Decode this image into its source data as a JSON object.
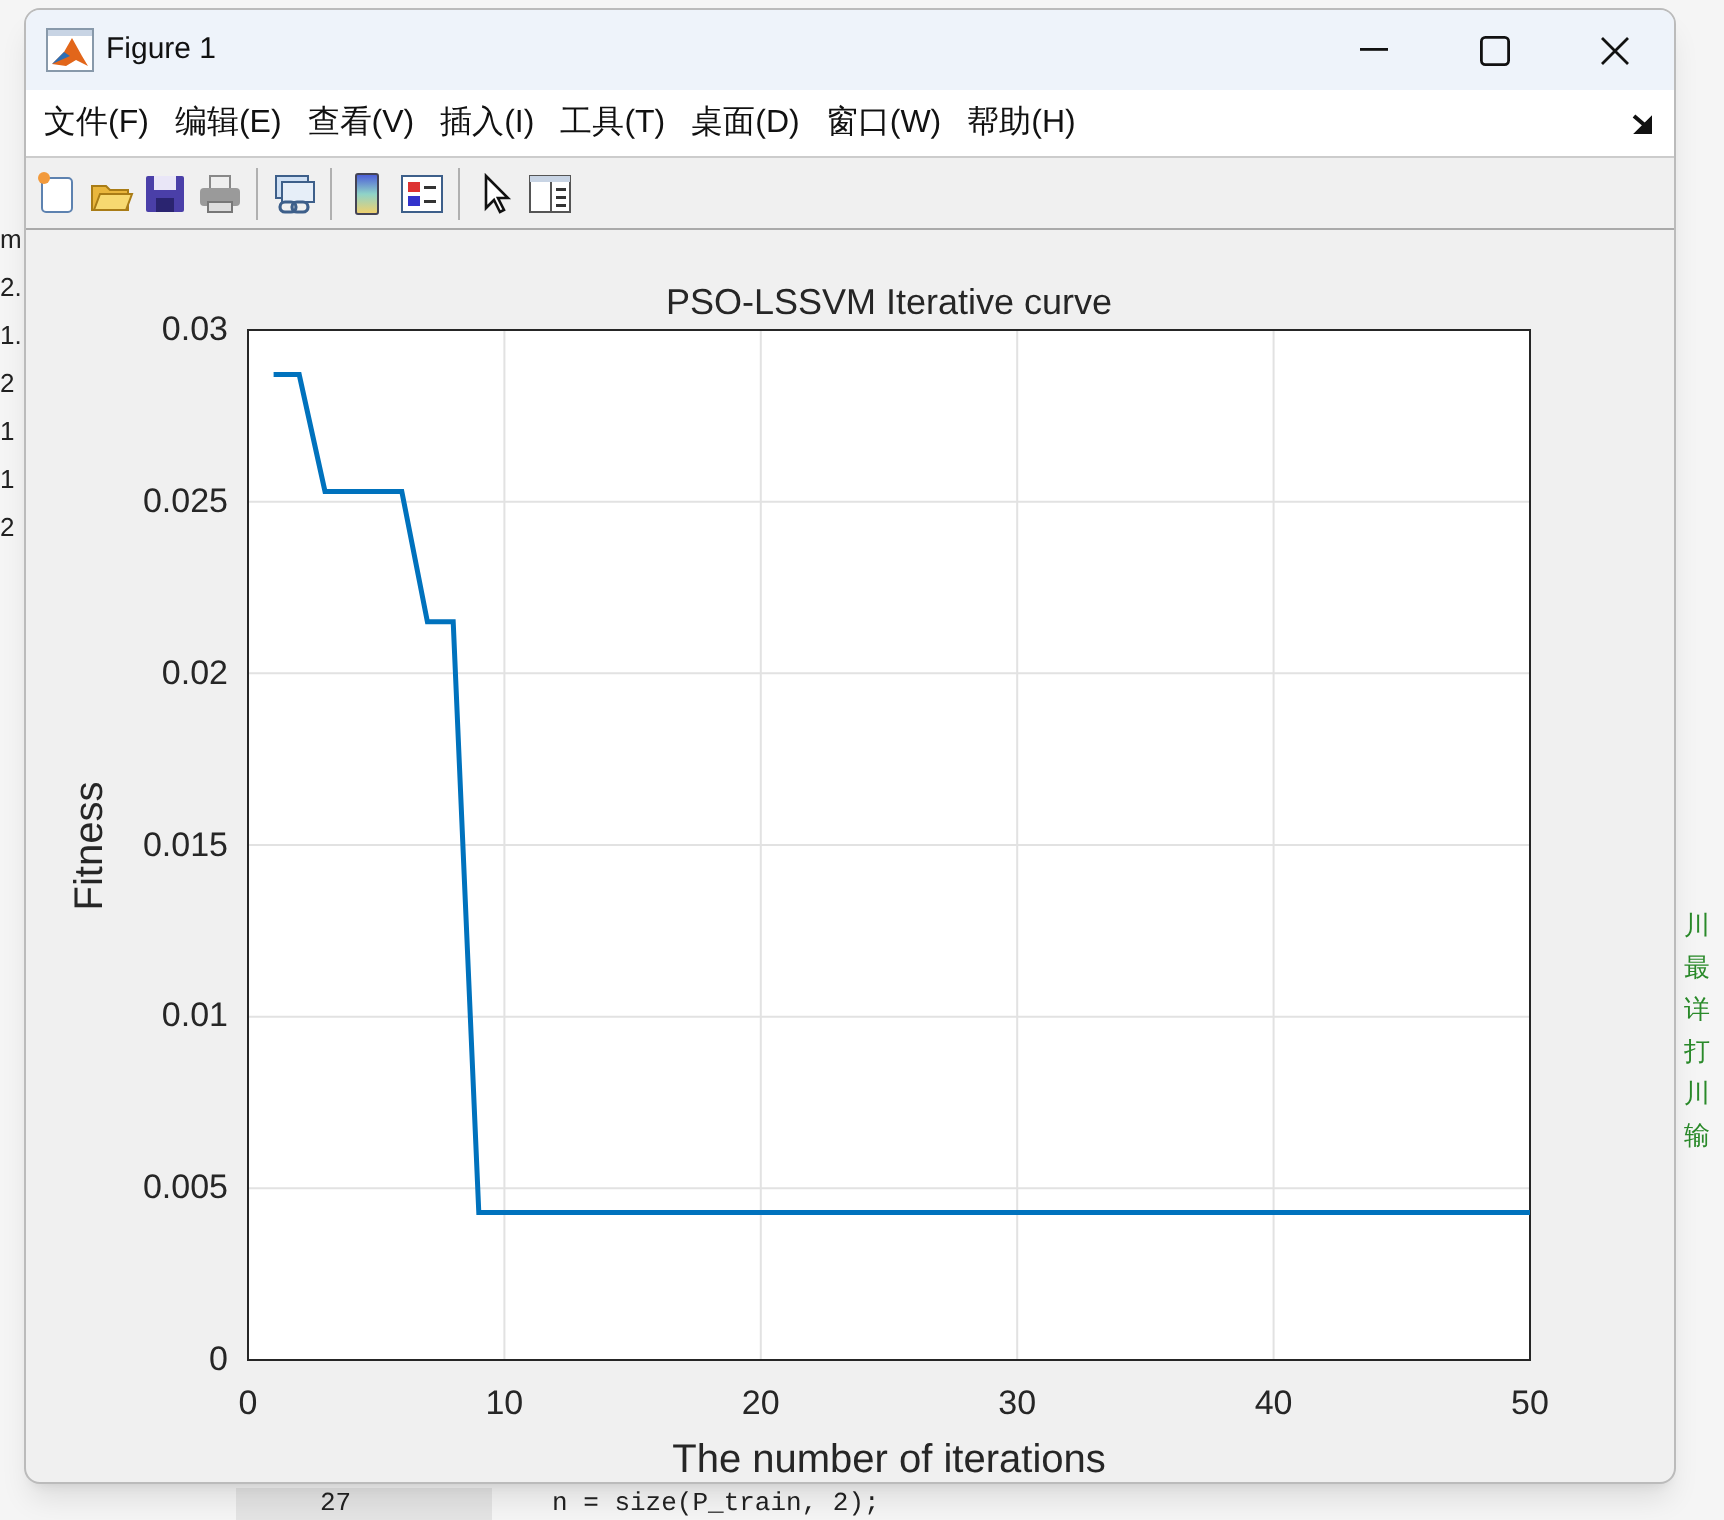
{
  "window": {
    "title": "Figure 1"
  },
  "menu": [
    {
      "label": "文件(F)"
    },
    {
      "label": "编辑(E)"
    },
    {
      "label": "查看(V)"
    },
    {
      "label": "插入(I)"
    },
    {
      "label": "工具(T)"
    },
    {
      "label": "桌面(D)"
    },
    {
      "label": "窗口(W)"
    },
    {
      "label": "帮助(H)"
    }
  ],
  "toolbar": [
    {
      "kind": "new"
    },
    {
      "kind": "open"
    },
    {
      "kind": "save"
    },
    {
      "kind": "print"
    },
    {
      "kind": "sep"
    },
    {
      "kind": "link"
    },
    {
      "kind": "sep"
    },
    {
      "kind": "colorbar"
    },
    {
      "kind": "legend"
    },
    {
      "kind": "sep"
    },
    {
      "kind": "pointer"
    },
    {
      "kind": "panel"
    }
  ],
  "plot": {
    "chart_data": {
      "type": "line",
      "title": "PSO-LSSVM Iterative curve",
      "xlabel": "The number of iterations",
      "ylabel": "Fitness",
      "x": [
        1,
        2,
        3,
        4,
        5,
        6,
        7,
        8,
        9,
        10,
        11,
        12,
        13,
        14,
        15,
        16,
        17,
        18,
        19,
        20,
        21,
        22,
        23,
        24,
        25,
        26,
        27,
        28,
        29,
        30,
        31,
        32,
        33,
        34,
        35,
        36,
        37,
        38,
        39,
        40,
        41,
        42,
        43,
        44,
        45,
        46,
        47,
        48,
        49,
        50
      ],
      "series": [
        {
          "color": "#0072bd",
          "values": [
            0.0287,
            0.0287,
            0.0253,
            0.0253,
            0.0253,
            0.0253,
            0.0215,
            0.0215,
            0.0043,
            0.0043,
            0.0043,
            0.0043,
            0.0043,
            0.0043,
            0.0043,
            0.0043,
            0.0043,
            0.0043,
            0.0043,
            0.0043,
            0.0043,
            0.0043,
            0.0043,
            0.0043,
            0.0043,
            0.0043,
            0.0043,
            0.0043,
            0.0043,
            0.0043,
            0.0043,
            0.0043,
            0.0043,
            0.0043,
            0.0043,
            0.0043,
            0.0043,
            0.0043,
            0.0043,
            0.0043,
            0.0043,
            0.0043,
            0.0043,
            0.0043,
            0.0043,
            0.0043,
            0.0043,
            0.0043,
            0.0043,
            0.0043
          ]
        }
      ],
      "grid": true,
      "xlim": [
        0,
        50
      ],
      "ylim": [
        0,
        0.03
      ],
      "xticks": [
        0,
        10,
        20,
        30,
        40,
        50
      ],
      "yticks": [
        {
          "value": 0,
          "label": "0"
        },
        {
          "value": 0.005,
          "label": "0.005"
        },
        {
          "value": 0.01,
          "label": "0.01"
        },
        {
          "value": 0.015,
          "label": "0.015"
        },
        {
          "value": 0.02,
          "label": "0.02"
        },
        {
          "value": 0.025,
          "label": "0.025"
        },
        {
          "value": 0.03,
          "label": "0.03"
        }
      ]
    }
  },
  "background_editor": {
    "left_fragments": [
      "m",
      "2.",
      "1.",
      "2",
      "1",
      "1",
      "2"
    ],
    "right_fragments": [
      "川",
      "最",
      "详",
      "打",
      "川",
      "输"
    ],
    "bottom_line": {
      "line_number": "27",
      "code": "n = size(P_train, 2);"
    }
  }
}
